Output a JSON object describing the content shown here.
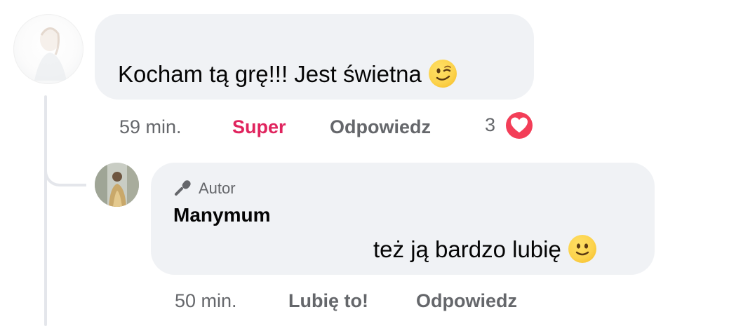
{
  "comment": {
    "text": "Kocham tą grę!!! Jest świetna",
    "emoji": "winking-face",
    "time": "59 min.",
    "reaction_label": "Super",
    "reply_label": "Odpowiedz",
    "reaction_count": "3",
    "reaction_icon": "heart-icon",
    "reaction_color": "#e0245e"
  },
  "reply": {
    "badge": "Autor",
    "author": "Manymum",
    "text": "też ją bardzo lubię",
    "emoji": "slightly-smiling-face",
    "time": "50 min.",
    "like_label": "Lubię to!",
    "reply_label": "Odpowiedz"
  },
  "colors": {
    "bubble": "#f0f2f5",
    "meta_text": "#65676b",
    "heart": "#f33e58"
  }
}
